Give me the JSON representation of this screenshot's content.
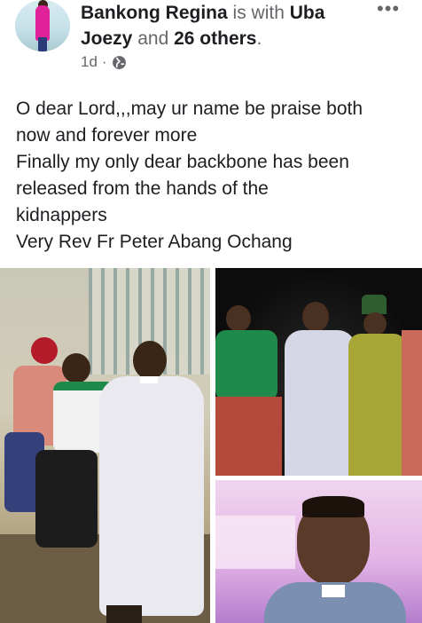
{
  "post": {
    "author": "Bankong Regina",
    "with_text": "is with",
    "tagged": "Uba",
    "tagged2": "Joezy",
    "and_text": "and",
    "others": "26 others",
    "period": ".",
    "time": "1d",
    "separator": "·",
    "audience_icon": "globe-icon",
    "menu_label": "•••"
  },
  "body": {
    "lines": [
      "O dear Lord,,,may ur name be praise both",
      "now and forever more",
      "Finally my only dear backbone has been",
      "released from the hands of the",
      "kidnappers",
      "Very Rev Fr Peter Abang Ochang"
    ]
  },
  "photos": {
    "count": 3,
    "colors": {
      "robe": "#e9e9ef",
      "green_shirt": "#1f8a4a",
      "pink_light": "#e3b5e6"
    }
  }
}
